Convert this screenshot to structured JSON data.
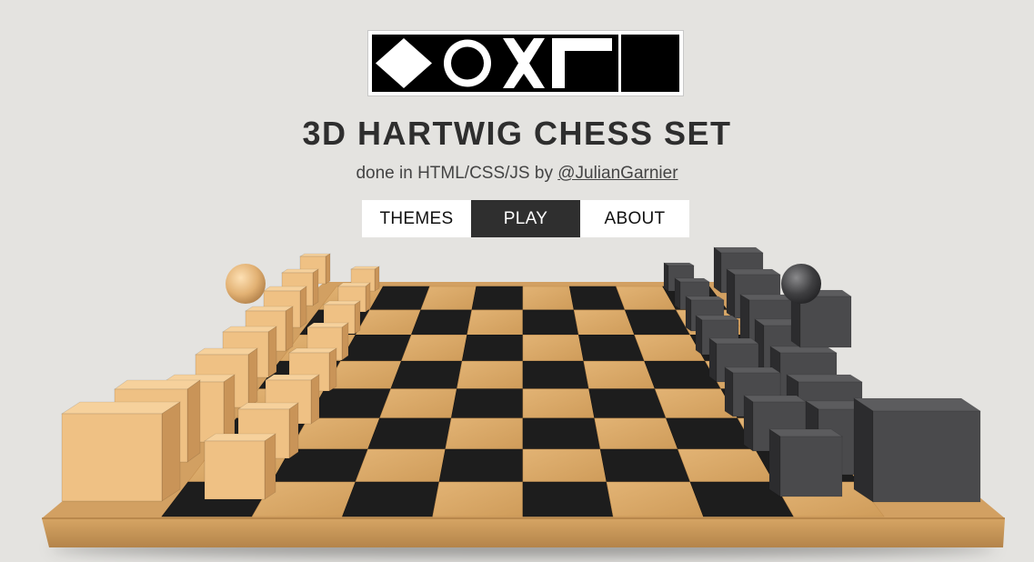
{
  "header": {
    "logo_alt": "Hartwig logo",
    "title": "3D HARTWIG CHESS SET",
    "subtitle_prefix": "done in HTML/CSS/JS by ",
    "author_link": "@JulianGarnier"
  },
  "menu": {
    "items": [
      {
        "label": "THEMES",
        "active": false
      },
      {
        "label": "PLAY",
        "active": true
      },
      {
        "label": "ABOUT",
        "active": false
      }
    ]
  },
  "board": {
    "files": 8,
    "ranks": 8,
    "light_square": "#d9a865",
    "dark_square": "#1d1d1d",
    "frame_color": "#c9995c",
    "white_pieces_color": "#f1c48a",
    "black_pieces_color": "#454547"
  },
  "colors": {
    "background": "#e4e3e0",
    "active_menu": "#2f2f2f"
  }
}
